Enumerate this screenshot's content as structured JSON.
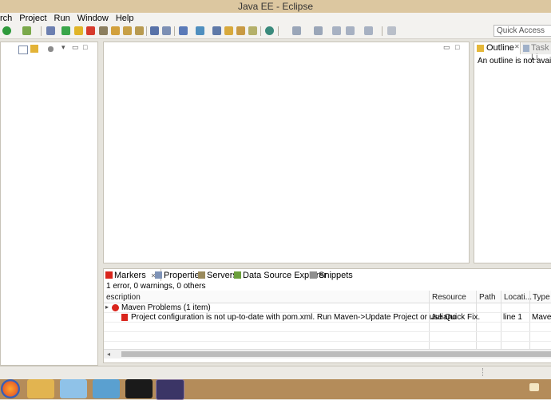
{
  "window": {
    "title": "Java EE - Eclipse"
  },
  "menu": {
    "items": [
      "rch",
      "Project",
      "Run",
      "Window",
      "Help"
    ]
  },
  "toolbar": {
    "quick_access_placeholder": "Quick Access"
  },
  "outline": {
    "tab_label": "Outline",
    "tab2_label": "Task Li",
    "message": "An outline is not available."
  },
  "markers": {
    "tabs": [
      "Markers",
      "Properties",
      "Servers",
      "Data Source Explorer",
      "Snippets"
    ],
    "summary": "1 error, 0 warnings, 0 others",
    "columns": [
      "escription",
      "Resource",
      "Path",
      "Locati...",
      "Type"
    ],
    "group": {
      "label": "Maven Problems (1 item)"
    },
    "problem": {
      "description": "Project configuration is not up-to-date with pom.xml. Run Maven->Update Project or use Quick Fix.",
      "resource": "Juliano",
      "path": "",
      "location": "line 1",
      "type": "Maven"
    }
  },
  "colors": {
    "title_bar": "#dcc7a0",
    "taskbar": "#b48c5a",
    "error": "#d9251c"
  }
}
